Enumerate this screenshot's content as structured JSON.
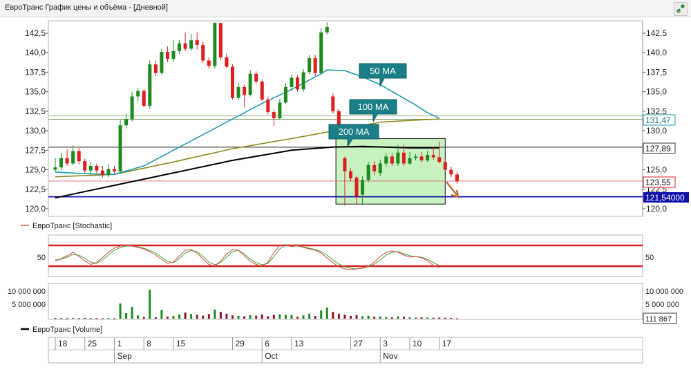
{
  "window": {
    "title": "ЕвроТранс График цены и объёма - [Дневной]",
    "restore_icon": "link-icon"
  },
  "price_axis": {
    "ticks": [
      "142,5",
      "140,0",
      "137,5",
      "135,0",
      "132,5",
      "130,0",
      "127,5",
      "125,0",
      "122,5",
      "120,0"
    ]
  },
  "badges": {
    "ma100_value": "131,47",
    "ma200_value": "127,89",
    "last_price": "123,55",
    "support": "121,54000"
  },
  "annotations": {
    "ma50": "50 MA",
    "ma100": "100 MA",
    "ma200": "200 MA"
  },
  "stochastic": {
    "legend": "ЕвроТранс [Stochastic]",
    "tick": "50"
  },
  "volume": {
    "legend": "ЕвроТранс [Volume]",
    "ticks": [
      "10 000 000",
      "5 000 000"
    ],
    "last_value": "111 867"
  },
  "time_axis": {
    "days": [
      "18",
      "25",
      "1",
      "8",
      "15",
      "29",
      "6",
      "13",
      "27",
      "3",
      "10",
      "17"
    ],
    "months": [
      "Sep",
      "Oct",
      "Nov"
    ]
  },
  "colors": {
    "up": "#1e8a1e",
    "down": "#dd1f1f",
    "ma50": "#1f9aaa",
    "ma100": "#8b8b1c",
    "ma200": "#000000",
    "support": "#1111aa",
    "callout": "#1a7f86",
    "highlight": "#c9f2c2"
  },
  "chart_data": {
    "type": "candlestick",
    "ylim": [
      120.0,
      143.9
    ],
    "candles": [
      {
        "o": 125.0,
        "c": 125.3,
        "h": 126.5,
        "l": 124.7
      },
      {
        "o": 125.3,
        "c": 126.5,
        "h": 127.2,
        "l": 125.0
      },
      {
        "o": 126.5,
        "c": 125.8,
        "h": 127.6,
        "l": 125.5
      },
      {
        "o": 125.8,
        "c": 127.4,
        "h": 128.1,
        "l": 125.6
      },
      {
        "o": 127.4,
        "c": 126.1,
        "h": 127.8,
        "l": 125.7
      },
      {
        "o": 126.1,
        "c": 124.9,
        "h": 126.4,
        "l": 124.6
      },
      {
        "o": 124.9,
        "c": 125.5,
        "h": 126.0,
        "l": 124.2
      },
      {
        "o": 125.5,
        "c": 124.9,
        "h": 125.8,
        "l": 124.6
      },
      {
        "o": 124.9,
        "c": 124.3,
        "h": 125.5,
        "l": 124.0
      },
      {
        "o": 124.3,
        "c": 125.1,
        "h": 125.7,
        "l": 124.0
      },
      {
        "o": 125.1,
        "c": 124.8,
        "h": 125.5,
        "l": 124.5
      },
      {
        "o": 124.8,
        "c": 130.7,
        "h": 131.4,
        "l": 124.6
      },
      {
        "o": 130.7,
        "c": 131.5,
        "h": 132.2,
        "l": 130.3
      },
      {
        "o": 131.5,
        "c": 134.4,
        "h": 135.0,
        "l": 131.2
      },
      {
        "o": 134.4,
        "c": 135.1,
        "h": 135.5,
        "l": 133.8
      },
      {
        "o": 135.1,
        "c": 133.2,
        "h": 135.3,
        "l": 133.0
      },
      {
        "o": 133.2,
        "c": 138.5,
        "h": 139.0,
        "l": 132.8
      },
      {
        "o": 138.5,
        "c": 137.4,
        "h": 139.0,
        "l": 137.0
      },
      {
        "o": 137.4,
        "c": 140.1,
        "h": 140.5,
        "l": 137.2
      },
      {
        "o": 140.1,
        "c": 139.2,
        "h": 140.8,
        "l": 138.8
      },
      {
        "o": 139.2,
        "c": 140.2,
        "h": 141.6,
        "l": 138.8
      },
      {
        "o": 140.2,
        "c": 141.2,
        "h": 141.6,
        "l": 139.8
      },
      {
        "o": 141.2,
        "c": 140.5,
        "h": 142.6,
        "l": 140.2
      },
      {
        "o": 140.5,
        "c": 141.6,
        "h": 142.4,
        "l": 140.2
      },
      {
        "o": 141.6,
        "c": 141.0,
        "h": 142.6,
        "l": 140.4
      },
      {
        "o": 141.0,
        "c": 139.0,
        "h": 141.4,
        "l": 138.7
      },
      {
        "o": 139.0,
        "c": 138.3,
        "h": 139.4,
        "l": 137.9
      },
      {
        "o": 138.3,
        "c": 143.8,
        "h": 143.9,
        "l": 138.0
      },
      {
        "o": 143.8,
        "c": 139.4,
        "h": 143.8,
        "l": 139.0
      },
      {
        "o": 139.4,
        "c": 138.2,
        "h": 139.9,
        "l": 138.0
      },
      {
        "o": 138.2,
        "c": 134.2,
        "h": 138.5,
        "l": 134.0
      },
      {
        "o": 134.2,
        "c": 135.6,
        "h": 136.1,
        "l": 133.9
      },
      {
        "o": 135.6,
        "c": 134.6,
        "h": 135.9,
        "l": 133.0
      },
      {
        "o": 134.6,
        "c": 137.3,
        "h": 137.8,
        "l": 134.4
      },
      {
        "o": 137.3,
        "c": 136.3,
        "h": 137.6,
        "l": 136.0
      },
      {
        "o": 136.3,
        "c": 134.0,
        "h": 136.6,
        "l": 133.8
      },
      {
        "o": 134.0,
        "c": 132.4,
        "h": 134.4,
        "l": 132.1
      },
      {
        "o": 132.4,
        "c": 131.6,
        "h": 132.7,
        "l": 130.6
      },
      {
        "o": 131.6,
        "c": 133.6,
        "h": 134.1,
        "l": 131.4
      },
      {
        "o": 133.6,
        "c": 135.6,
        "h": 136.1,
        "l": 133.4
      },
      {
        "o": 135.6,
        "c": 136.8,
        "h": 137.2,
        "l": 135.1
      },
      {
        "o": 136.8,
        "c": 135.3,
        "h": 137.1,
        "l": 135.0
      },
      {
        "o": 135.3,
        "c": 137.5,
        "h": 137.9,
        "l": 135.0
      },
      {
        "o": 137.5,
        "c": 139.3,
        "h": 139.7,
        "l": 137.2
      },
      {
        "o": 139.3,
        "c": 137.4,
        "h": 139.7,
        "l": 137.0
      },
      {
        "o": 137.4,
        "c": 142.6,
        "h": 143.1,
        "l": 137.2
      },
      {
        "o": 142.6,
        "c": 143.3,
        "h": 143.9,
        "l": 142.3
      },
      {
        "o": 134.4,
        "c": 132.5,
        "h": 134.8,
        "l": 132.2
      },
      {
        "o": 132.5,
        "c": 130.6,
        "h": 132.8,
        "l": 130.2
      },
      {
        "o": 126.5,
        "c": 124.8,
        "h": 126.7,
        "l": 120.4
      },
      {
        "o": 124.8,
        "c": 123.9,
        "h": 125.2,
        "l": 123.5
      },
      {
        "o": 124.0,
        "c": 121.6,
        "h": 124.2,
        "l": 120.6
      },
      {
        "o": 121.8,
        "c": 123.7,
        "h": 124.2,
        "l": 120.5
      },
      {
        "o": 123.7,
        "c": 125.6,
        "h": 126.0,
        "l": 123.4
      },
      {
        "o": 125.6,
        "c": 124.8,
        "h": 126.1,
        "l": 124.3
      },
      {
        "o": 124.6,
        "c": 125.8,
        "h": 126.3,
        "l": 124.2
      },
      {
        "o": 125.8,
        "c": 126.7,
        "h": 127.1,
        "l": 125.4
      },
      {
        "o": 126.7,
        "c": 125.8,
        "h": 127.1,
        "l": 125.5
      },
      {
        "o": 125.8,
        "c": 127.2,
        "h": 128.2,
        "l": 125.5
      },
      {
        "o": 127.2,
        "c": 125.8,
        "h": 128.2,
        "l": 125.5
      },
      {
        "o": 125.8,
        "c": 126.5,
        "h": 127.3,
        "l": 125.6
      },
      {
        "o": 126.5,
        "c": 126.7,
        "h": 127.0,
        "l": 126.2
      },
      {
        "o": 126.7,
        "c": 126.2,
        "h": 127.3,
        "l": 125.9
      },
      {
        "o": 126.2,
        "c": 126.9,
        "h": 127.4,
        "l": 126.0
      },
      {
        "o": 126.9,
        "c": 126.6,
        "h": 127.9,
        "l": 126.3
      },
      {
        "o": 126.6,
        "c": 126.0,
        "h": 128.6,
        "l": 125.8
      },
      {
        "o": 126.0,
        "c": 125.0,
        "h": 126.4,
        "l": 124.8
      },
      {
        "o": 125.0,
        "c": 124.4,
        "h": 125.4,
        "l": 124.0
      },
      {
        "o": 124.4,
        "c": 123.5,
        "h": 124.8,
        "l": 123.2
      }
    ],
    "ma50": [
      [
        0,
        124.7
      ],
      [
        5,
        124.5
      ],
      [
        10,
        124.4
      ],
      [
        15,
        125.5
      ],
      [
        20,
        127.5
      ],
      [
        25,
        129.5
      ],
      [
        30,
        131.5
      ],
      [
        35,
        133.5
      ],
      [
        40,
        135.3
      ],
      [
        45,
        137.3
      ],
      [
        46,
        137.8
      ],
      [
        49,
        137.7
      ],
      [
        52,
        136.9
      ],
      [
        55,
        135.9
      ],
      [
        58,
        134.6
      ],
      [
        61,
        133.3
      ],
      [
        63,
        132.3
      ],
      [
        65,
        131.6
      ]
    ],
    "ma100": [
      [
        0,
        124.1
      ],
      [
        10,
        124.4
      ],
      [
        20,
        126.0
      ],
      [
        30,
        127.7
      ],
      [
        40,
        129.0
      ],
      [
        48,
        130.1
      ],
      [
        55,
        131.1
      ],
      [
        62,
        131.4
      ],
      [
        65,
        131.5
      ]
    ],
    "ma200": [
      [
        0,
        121.4
      ],
      [
        10,
        123.0
      ],
      [
        20,
        124.6
      ],
      [
        30,
        126.2
      ],
      [
        40,
        127.5
      ],
      [
        47,
        127.9
      ],
      [
        52,
        128.0
      ],
      [
        60,
        127.8
      ],
      [
        65,
        127.8
      ]
    ],
    "horizontal_levels": [
      131.47,
      127.89,
      123.55,
      121.54
    ],
    "highlight_box": {
      "x_from": 47.5,
      "x_to": 66,
      "y_from": 120.6,
      "y_to": 129.0
    },
    "stochastic": {
      "k": [
        35,
        42,
        50,
        60,
        48,
        35,
        25,
        30,
        45,
        60,
        72,
        78,
        80,
        78,
        74,
        70,
        62,
        52,
        40,
        28,
        32,
        50,
        66,
        68,
        58,
        40,
        25,
        20,
        35,
        55,
        68,
        66,
        50,
        34,
        25,
        20,
        32,
        60,
        80,
        82,
        76,
        80,
        74,
        70,
        66,
        58,
        44,
        30,
        18,
        12,
        10,
        12,
        15,
        20,
        32,
        48,
        60,
        64,
        60,
        52,
        46,
        48,
        44,
        36,
        22,
        16
      ],
      "d": [
        38,
        40,
        46,
        54,
        52,
        42,
        32,
        28,
        38,
        52,
        66,
        74,
        78,
        78,
        76,
        72,
        66,
        58,
        46,
        34,
        30,
        42,
        58,
        66,
        62,
        48,
        32,
        24,
        30,
        46,
        62,
        66,
        56,
        40,
        30,
        24,
        28,
        48,
        70,
        80,
        78,
        78,
        76,
        72,
        68,
        62,
        52,
        38,
        26,
        18,
        14,
        12,
        14,
        18,
        26,
        38,
        52,
        60,
        62,
        56,
        50,
        48,
        46,
        40,
        30,
        22
      ],
      "levels": [
        20,
        80
      ]
    },
    "volume": [
      {
        "v": 200000,
        "up": false
      },
      {
        "v": 250000,
        "up": true
      },
      {
        "v": 150000,
        "up": false
      },
      {
        "v": 300000,
        "up": true
      },
      {
        "v": 200000,
        "up": false
      },
      {
        "v": 250000,
        "up": false
      },
      {
        "v": 200000,
        "up": true
      },
      {
        "v": 180000,
        "up": false
      },
      {
        "v": 150000,
        "up": false
      },
      {
        "v": 220000,
        "up": true
      },
      {
        "v": 120000,
        "up": false
      },
      {
        "v": 5500000,
        "up": true
      },
      {
        "v": 2000000,
        "up": true
      },
      {
        "v": 4300000,
        "up": true
      },
      {
        "v": 1200000,
        "up": true
      },
      {
        "v": 700000,
        "up": false
      },
      {
        "v": 10500000,
        "up": true
      },
      {
        "v": 500000,
        "up": false
      },
      {
        "v": 3200000,
        "up": true
      },
      {
        "v": 800000,
        "up": false
      },
      {
        "v": 1000000,
        "up": true
      },
      {
        "v": 1500000,
        "up": true
      },
      {
        "v": 2200000,
        "up": false
      },
      {
        "v": 1700000,
        "up": true
      },
      {
        "v": 1400000,
        "up": false
      },
      {
        "v": 1100000,
        "up": false
      },
      {
        "v": 1700000,
        "up": false
      },
      {
        "v": 3300000,
        "up": true
      },
      {
        "v": 2500000,
        "up": false
      },
      {
        "v": 1800000,
        "up": false
      },
      {
        "v": 1200000,
        "up": false
      },
      {
        "v": 1000000,
        "up": true
      },
      {
        "v": 900000,
        "up": false
      },
      {
        "v": 1300000,
        "up": true
      },
      {
        "v": 1100000,
        "up": false
      },
      {
        "v": 1600000,
        "up": false
      },
      {
        "v": 900000,
        "up": false
      },
      {
        "v": 1400000,
        "up": false
      },
      {
        "v": 1600000,
        "up": true
      },
      {
        "v": 1400000,
        "up": true
      },
      {
        "v": 1300000,
        "up": true
      },
      {
        "v": 700000,
        "up": false
      },
      {
        "v": 1200000,
        "up": true
      },
      {
        "v": 1800000,
        "up": true
      },
      {
        "v": 1000000,
        "up": false
      },
      {
        "v": 3000000,
        "up": true
      },
      {
        "v": 4000000,
        "up": true
      },
      {
        "v": 2500000,
        "up": false
      },
      {
        "v": 1800000,
        "up": false
      },
      {
        "v": 1500000,
        "up": false
      },
      {
        "v": 1000000,
        "up": false
      },
      {
        "v": 1300000,
        "up": false
      },
      {
        "v": 900000,
        "up": true
      },
      {
        "v": 1100000,
        "up": true
      },
      {
        "v": 700000,
        "up": false
      },
      {
        "v": 800000,
        "up": true
      },
      {
        "v": 600000,
        "up": true
      },
      {
        "v": 500000,
        "up": false
      },
      {
        "v": 900000,
        "up": true
      },
      {
        "v": 700000,
        "up": false
      },
      {
        "v": 500000,
        "up": true
      },
      {
        "v": 400000,
        "up": true
      },
      {
        "v": 500000,
        "up": false
      },
      {
        "v": 400000,
        "up": true
      },
      {
        "v": 350000,
        "up": false
      },
      {
        "v": 400000,
        "up": false
      },
      {
        "v": 300000,
        "up": false
      },
      {
        "v": 250000,
        "up": false
      },
      {
        "v": 111867,
        "up": false
      }
    ]
  }
}
